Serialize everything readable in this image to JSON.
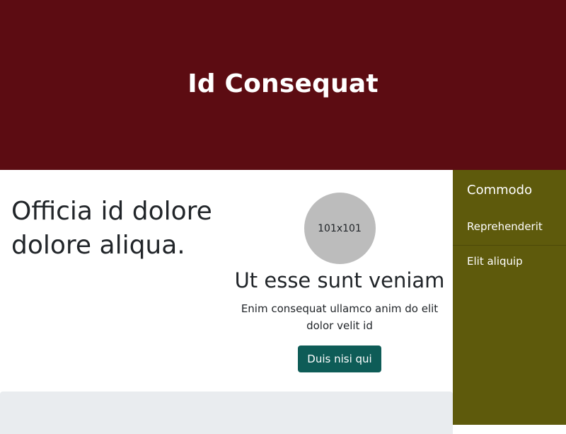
{
  "header": {
    "title": "Id Consequat"
  },
  "main": {
    "headline": "Officia id dolore dolore aliqua.",
    "card": {
      "image_text": "101x101",
      "title": "Ut esse sunt veniam",
      "text": "Enim consequat ullamco anim do elit dolor velit id",
      "button_label": "Duis nisi qui"
    }
  },
  "sidebar": {
    "heading": "Commodo",
    "items": [
      {
        "label": "Reprehenderit"
      },
      {
        "label": "Elit aliquip"
      }
    ]
  },
  "colors": {
    "header_bg": "#5c0c12",
    "sidebar_bg": "#5e5a0c",
    "button_bg": "#0e5c57",
    "placeholder_bg": "#bcbcbc",
    "panel_bg": "#e9ecef"
  }
}
